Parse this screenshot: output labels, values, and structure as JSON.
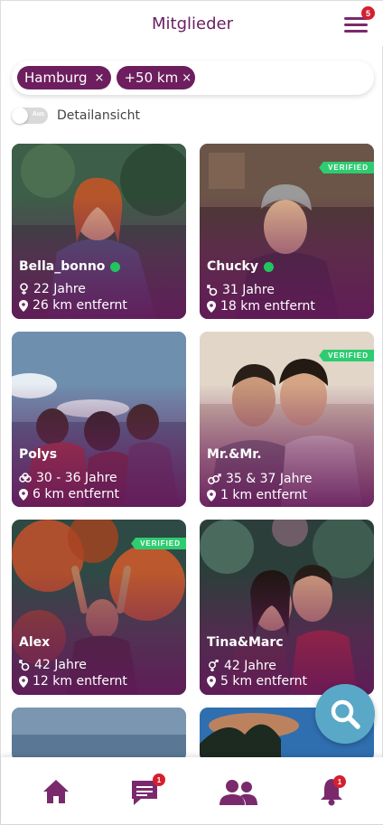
{
  "header": {
    "title": "Mitglieder",
    "menu_badge": "5"
  },
  "filters": [
    {
      "label": "Hamburg",
      "remove": "×"
    },
    {
      "label": "+50 km",
      "remove": "×"
    }
  ],
  "detail_toggle": {
    "state_text": "Aus",
    "label": "Detailansicht"
  },
  "verified_text": "VERIFIED",
  "members": [
    {
      "name": "Bella_bonno",
      "online": true,
      "verified": false,
      "age": "22 Jahre",
      "distance": "26 km entfernt",
      "gender_icon": "female-icon"
    },
    {
      "name": "Chucky",
      "online": true,
      "verified": true,
      "age": "31 Jahre",
      "distance": "18 km entfernt",
      "gender_icon": "nonbinary-icon"
    },
    {
      "name": "Polys",
      "online": false,
      "verified": false,
      "age": "30 - 36 Jahre",
      "distance": "6 km entfernt",
      "gender_icon": "group-icon"
    },
    {
      "name": "Mr.&Mr.",
      "online": false,
      "verified": true,
      "age": "35 & 37 Jahre",
      "distance": "1 km entfernt",
      "gender_icon": "male-couple-icon"
    },
    {
      "name": "Alex",
      "online": false,
      "verified": true,
      "age": "42 Jahre",
      "distance": "12 km entfernt",
      "gender_icon": "nonbinary-icon"
    },
    {
      "name": "Tina&Marc",
      "online": false,
      "verified": false,
      "age": "42 Jahre",
      "distance": "5 km entfernt",
      "gender_icon": "couple-icon"
    }
  ],
  "nav": {
    "messages_badge": "1",
    "notifications_badge": "1"
  },
  "colors": {
    "brand": "#6d1e5e",
    "online": "#22c55e",
    "verified": "#2ecc71",
    "fab": "#5aa8c8",
    "badge": "#d4202e"
  }
}
